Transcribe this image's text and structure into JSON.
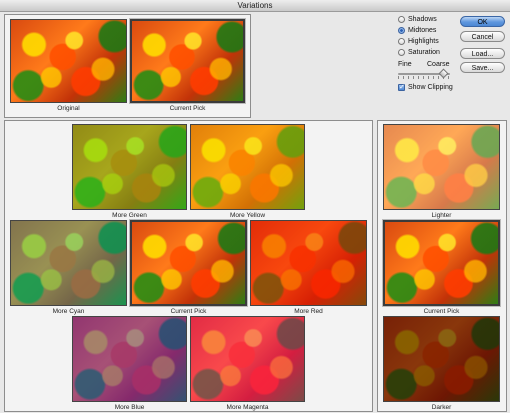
{
  "window": {
    "title": "Variations"
  },
  "top": {
    "original_caption": "Original",
    "current_pick_caption": "Current Pick"
  },
  "controls": {
    "options": [
      {
        "label": "Shadows",
        "selected": false
      },
      {
        "label": "Midtones",
        "selected": true
      },
      {
        "label": "Highlights",
        "selected": false
      },
      {
        "label": "Saturation",
        "selected": false
      }
    ],
    "slider": {
      "min_label": "Fine",
      "max_label": "Coarse",
      "value_fraction": 0.8
    },
    "show_clipping": {
      "label": "Show Clipping",
      "checked": true
    }
  },
  "buttons": {
    "ok": "OK",
    "cancel": "Cancel",
    "load": "Load...",
    "save": "Save..."
  },
  "color_grid": {
    "more_green": "More Green",
    "more_yellow": "More Yellow",
    "more_cyan": "More Cyan",
    "current_pick": "Current Pick",
    "more_red": "More Red",
    "more_blue": "More Blue",
    "more_magenta": "More Magenta"
  },
  "brightness": {
    "lighter": "Lighter",
    "current_pick": "Current Pick",
    "darker": "Darker"
  },
  "colors": {
    "green": "#22cc22",
    "yellow": "#e6e600",
    "cyan": "#00b3b3",
    "red": "#ff0000",
    "blue": "#2a2aff",
    "magenta": "#ff00cc"
  }
}
